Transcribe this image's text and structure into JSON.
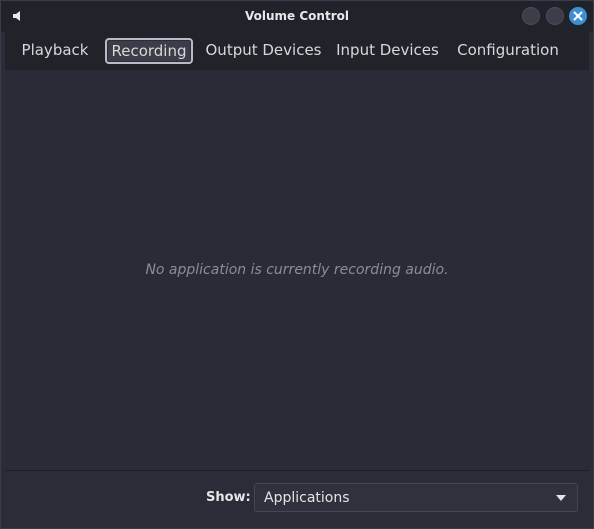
{
  "window": {
    "title": "Volume Control"
  },
  "tabs": [
    {
      "label": "Playback",
      "active": false
    },
    {
      "label": "Recording",
      "active": true
    },
    {
      "label": "Output Devices",
      "active": false
    },
    {
      "label": "Input Devices",
      "active": false
    },
    {
      "label": "Configuration",
      "active": false
    }
  ],
  "content": {
    "empty_message": "No application is currently recording audio."
  },
  "footer": {
    "show_label": "Show:",
    "show_value": "Applications"
  },
  "icons": {
    "app": "speaker-icon",
    "close": "close-icon",
    "dropdown": "chevron-down-icon"
  },
  "colors": {
    "accent": "#3d8fd1",
    "background": "#2a2d37"
  }
}
